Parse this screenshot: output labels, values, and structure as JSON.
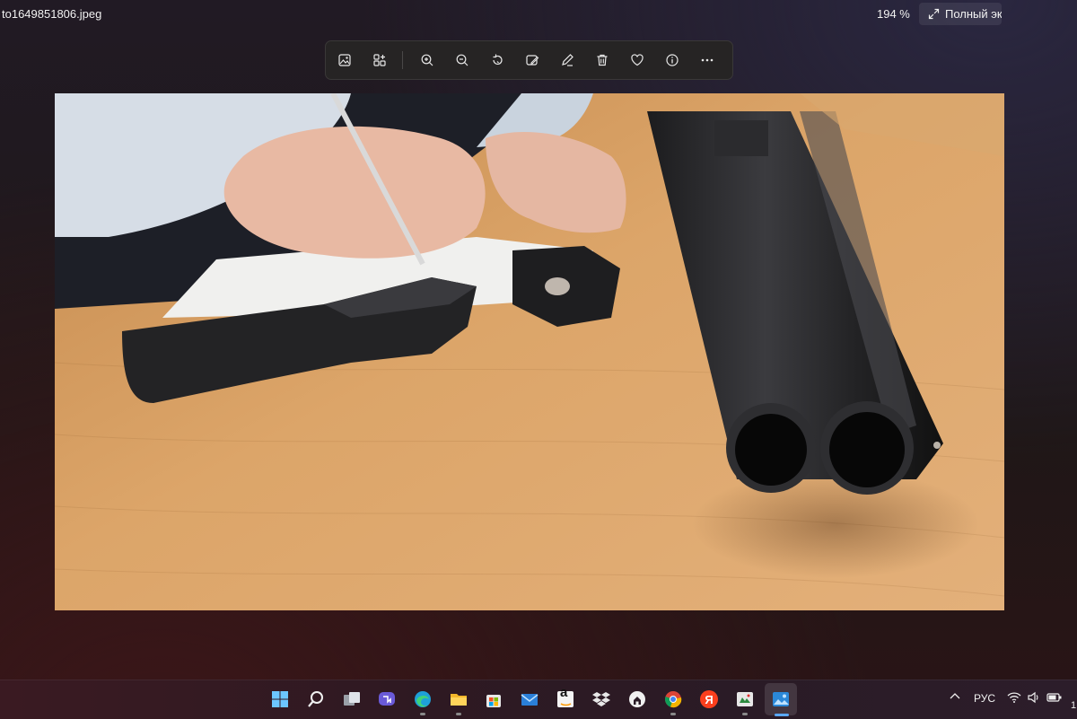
{
  "window": {
    "title": "to1649851806.jpeg",
    "zoom_level": "194 %",
    "fullscreen_label": "Полный эк"
  },
  "toolbar": {
    "buttons": [
      {
        "name": "edit-image-icon"
      },
      {
        "name": "crop-icon"
      },
      {
        "name": "zoom-in-icon"
      },
      {
        "name": "zoom-out-icon"
      },
      {
        "name": "rotate-icon"
      },
      {
        "name": "edit-icon"
      },
      {
        "name": "draw-icon"
      },
      {
        "name": "delete-icon"
      },
      {
        "name": "favorite-icon"
      },
      {
        "name": "info-icon"
      },
      {
        "name": "more-icon"
      }
    ]
  },
  "photo": {
    "description_icon": "photo-icon"
  },
  "taskbar": {
    "apps": [
      "start-icon",
      "search-icon",
      "task-view-icon",
      "teams-icon",
      "edge-icon",
      "file-explorer-icon",
      "store-icon",
      "mail-icon",
      "amazon-icon",
      "dropbox-icon",
      "github-icon",
      "chrome-icon",
      "yandex-icon",
      "photos-icon"
    ],
    "yandex_letter": "Я",
    "amazon_letter": "a",
    "language": "РУС",
    "clock_partial": "1"
  },
  "colors": {
    "accent": "#5aa8ff",
    "toolbar_bg": "#262424",
    "table_wood": "#d9a263"
  }
}
